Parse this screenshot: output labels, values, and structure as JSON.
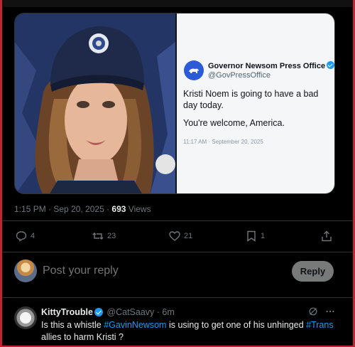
{
  "media": {
    "card": {
      "org_name": "Governor Newsom Press Office",
      "handle": "@GovPressOffice",
      "body_line1": "Kristi Noem is going to have a bad day today.",
      "body_line2": "You're welcome, America.",
      "stamp": "11:17 AM · September 20, 2025"
    }
  },
  "meta": {
    "time_date": "1:15 PM · Sep 20, 2025 · ",
    "views_count": "693",
    "views_label": " Views"
  },
  "actions": {
    "replies": "4",
    "reposts": "23",
    "likes": "21",
    "bookmarks": "1"
  },
  "reply_box": {
    "placeholder": "Post your reply",
    "button_label": "Reply"
  },
  "comment": {
    "name": "KittyTrouble",
    "handle": "@CatSaavy · 6m",
    "text_1": "Is this a whistle ",
    "hashtag_1": "#GavinNewsom",
    "text_2": " is using to get one of his unhinged ",
    "hashtag_2": "#Trans",
    "text_3": " allies to harm Kristi ?"
  },
  "colors": {
    "accent": "#1d9bf0",
    "frame": "#c0262d",
    "background": "#000000"
  }
}
